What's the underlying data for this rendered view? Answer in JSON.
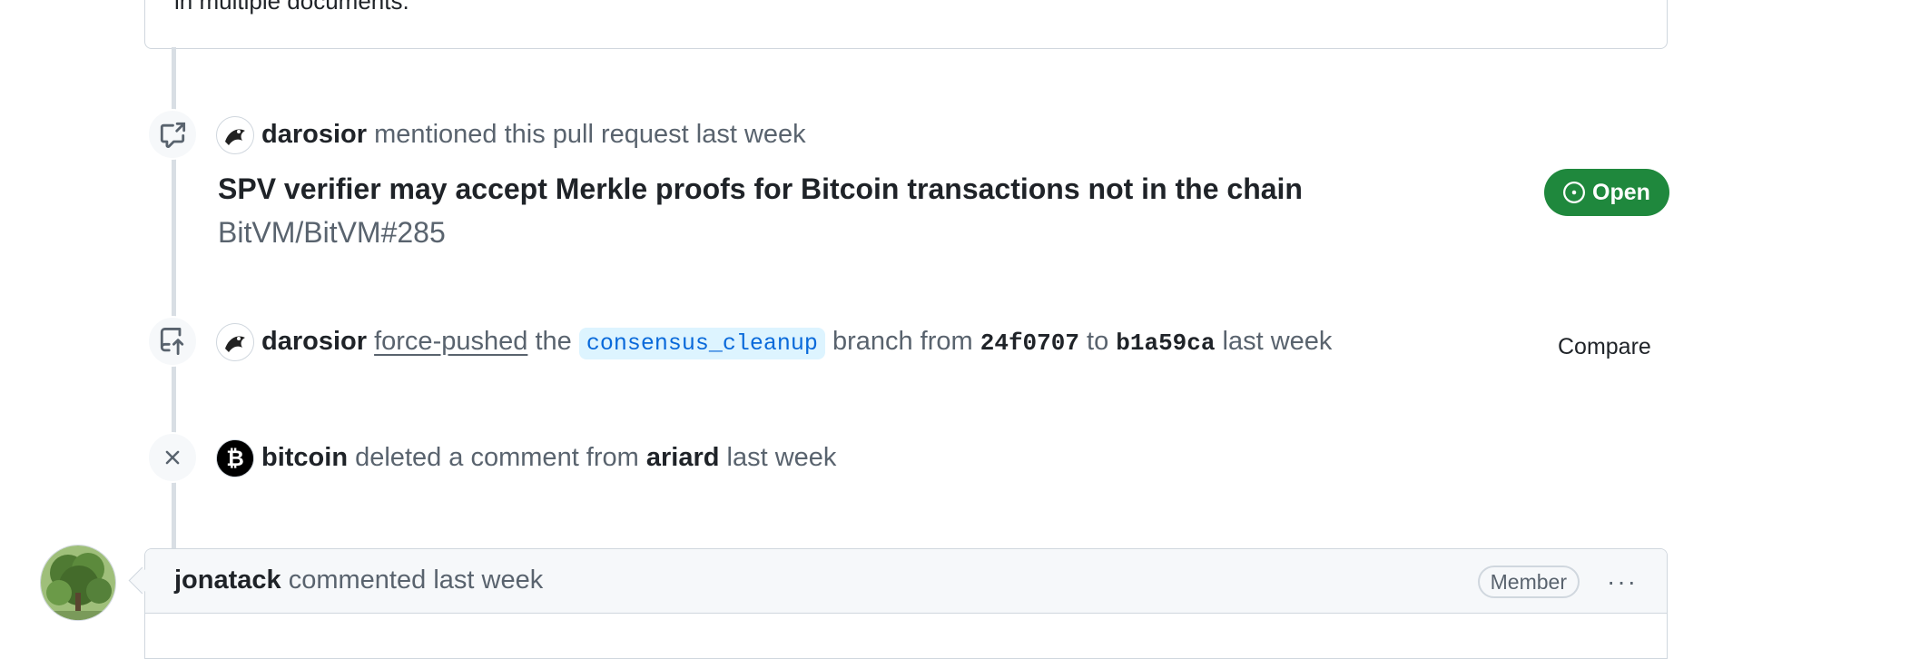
{
  "previous_comment": {
    "tail_text": "in multiple documents."
  },
  "events": {
    "mention": {
      "actor": "darosior",
      "action": "mentioned this pull request",
      "time": "last week",
      "icon": "cross-reference-icon",
      "ref_title": "SPV verifier may accept Merkle proofs for Bitcoin transactions not in the chain",
      "ref_number": "BitVM/BitVM#285",
      "state_label": "Open",
      "state_color": "#1f883d"
    },
    "force_push": {
      "actor": "darosior",
      "link_text": "force-pushed",
      "the": "the",
      "branch": "consensus_cleanup",
      "branch_word": "branch from",
      "from_sha": "24f0707",
      "to_word": "to",
      "to_sha": "b1a59ca",
      "time": "last week",
      "icon": "repo-push-icon",
      "compare_label": "Compare"
    },
    "deleted_comment": {
      "actor": "bitcoin",
      "action": "deleted a comment from",
      "target_user": "ariard",
      "time": "last week",
      "icon": "x-icon"
    }
  },
  "comment": {
    "author": "jonatack",
    "action": "commented",
    "time": "last week",
    "role_badge": "Member",
    "menu_label": "···"
  }
}
